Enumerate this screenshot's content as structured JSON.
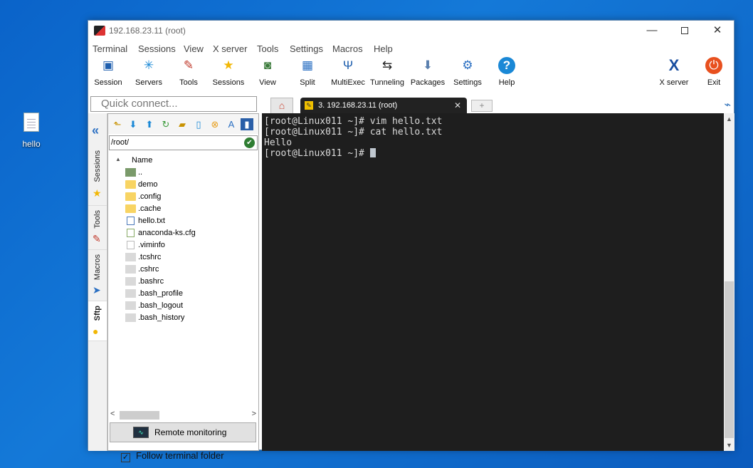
{
  "desktop": {
    "icon_label": "hello"
  },
  "window": {
    "title": "192.168.23.11 (root)",
    "controls": {
      "minimize": "—",
      "close": "✕"
    }
  },
  "menu": [
    "Terminal",
    "Sessions",
    "View",
    "X server",
    "Tools",
    "Settings",
    "Macros",
    "Help"
  ],
  "toolbar": [
    {
      "label": "Session",
      "icon": "monitor-icon"
    },
    {
      "label": "Servers",
      "icon": "network-icon"
    },
    {
      "label": "Tools",
      "icon": "wrench-icon"
    },
    {
      "label": "Sessions",
      "icon": "star-icon"
    },
    {
      "label": "View",
      "icon": "view-icon"
    },
    {
      "label": "Split",
      "icon": "split-icon"
    },
    {
      "label": "MultiExec",
      "icon": "fork-icon"
    },
    {
      "label": "Tunneling",
      "icon": "tunnel-icon"
    },
    {
      "label": "Packages",
      "icon": "package-icon"
    },
    {
      "label": "Settings",
      "icon": "gear-icon"
    },
    {
      "label": "Help",
      "icon": "help-icon"
    },
    {
      "label": "X server",
      "icon": "x-server-icon"
    },
    {
      "label": "Exit",
      "icon": "power-icon"
    }
  ],
  "quick_connect": {
    "placeholder": "Quick connect..."
  },
  "tabs": {
    "session_tab": "3. 192.168.23.11 (root)",
    "close": "✕",
    "new": "+"
  },
  "side_tabs": [
    "Sessions",
    "Tools",
    "Macros",
    "Sftp"
  ],
  "sftp": {
    "path": "/root/",
    "column_name": "Name",
    "files": [
      {
        "name": "..",
        "type": "up"
      },
      {
        "name": "demo",
        "type": "folder"
      },
      {
        "name": ".config",
        "type": "folder"
      },
      {
        "name": ".cache",
        "type": "folder"
      },
      {
        "name": "hello.txt",
        "type": "doc"
      },
      {
        "name": "anaconda-ks.cfg",
        "type": "cfg"
      },
      {
        "name": ".viminfo",
        "type": "doc"
      },
      {
        "name": ".tcshrc",
        "type": "hidden"
      },
      {
        "name": ".cshrc",
        "type": "hidden"
      },
      {
        "name": ".bashrc",
        "type": "hidden"
      },
      {
        "name": ".bash_profile",
        "type": "hidden"
      },
      {
        "name": ".bash_logout",
        "type": "hidden"
      },
      {
        "name": ".bash_history",
        "type": "hidden"
      }
    ],
    "remote_monitoring": "Remote monitoring",
    "follow_terminal_folder": "Follow terminal folder",
    "follow_checked": true
  },
  "terminal": {
    "lines": [
      "[root@Linux011 ~]# vim hello.txt",
      "[root@Linux011 ~]# cat hello.txt",
      "Hello",
      "[root@Linux011 ~]# "
    ]
  }
}
